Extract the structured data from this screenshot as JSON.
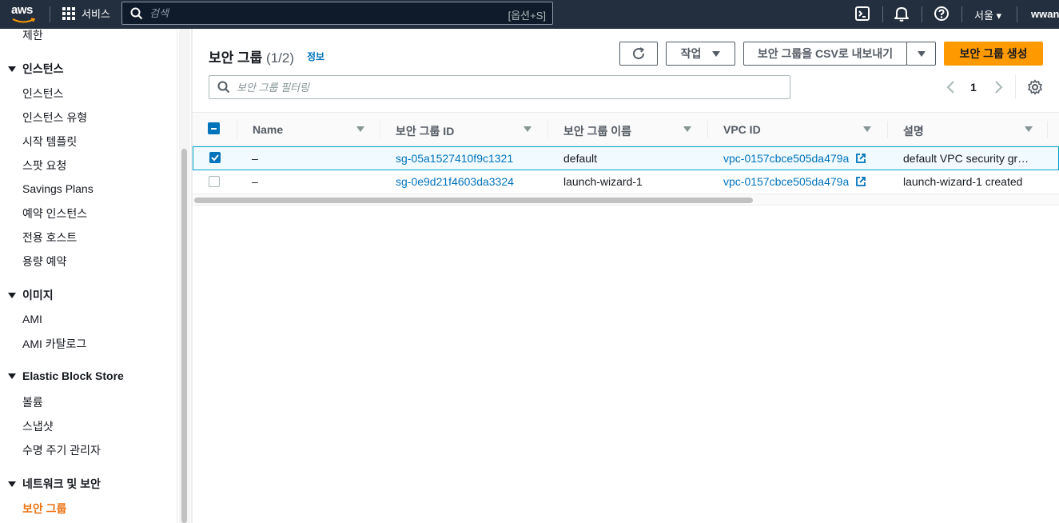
{
  "topnav": {
    "logo_text": "aws",
    "services_label": "서비스",
    "search_placeholder": "검색",
    "search_shortcut": "[옵션+S]",
    "region_label": "서울 ▾",
    "user_label": "wwan"
  },
  "sidebar": {
    "items": [
      {
        "label": "제한",
        "type": "item"
      },
      {
        "label": "인스턴스",
        "type": "section"
      },
      {
        "label": "인스턴스",
        "type": "item"
      },
      {
        "label": "인스턴스 유형",
        "type": "item"
      },
      {
        "label": "시작 템플릿",
        "type": "item"
      },
      {
        "label": "스팟 요청",
        "type": "item"
      },
      {
        "label": "Savings Plans",
        "type": "item"
      },
      {
        "label": "예약 인스턴스",
        "type": "item"
      },
      {
        "label": "전용 호스트",
        "type": "item"
      },
      {
        "label": "용량 예약",
        "type": "item"
      },
      {
        "label": "이미지",
        "type": "section"
      },
      {
        "label": "AMI",
        "type": "item"
      },
      {
        "label": "AMI 카탈로그",
        "type": "item"
      },
      {
        "label": "Elastic Block Store",
        "type": "section"
      },
      {
        "label": "볼륨",
        "type": "item"
      },
      {
        "label": "스냅샷",
        "type": "item"
      },
      {
        "label": "수명 주기 관리자",
        "type": "item"
      },
      {
        "label": "네트워크 및 보안",
        "type": "section"
      },
      {
        "label": "보안 그룹",
        "type": "item",
        "active": true
      }
    ]
  },
  "panel": {
    "title": "보안 그룹",
    "count": "(1/2)",
    "info_link": "정보",
    "actions_label": "작업",
    "export_label": "보안 그룹을 CSV로 내보내기",
    "create_label": "보안 그룹 생성",
    "filter_placeholder": "보안 그룹 필터링",
    "page_number": "1"
  },
  "table": {
    "columns": [
      "Name",
      "보안 그룹 ID",
      "보안 그룹 이름",
      "VPC ID",
      "설명"
    ],
    "rows": [
      {
        "selected": true,
        "name": "–",
        "sg_id": "sg-05a1527410f9c1321",
        "sg_name": "default",
        "vpc_id": "vpc-0157cbce505da479a",
        "description": "default VPC security group"
      },
      {
        "selected": false,
        "name": "–",
        "sg_id": "sg-0e9d21f4603da3324",
        "sg_name": "launch-wizard-1",
        "vpc_id": "vpc-0157cbce505da479a",
        "description": "launch-wizard-1 created"
      }
    ]
  },
  "colors": {
    "nav_bg": "#232f3e",
    "accent_orange": "#ff9900",
    "active_link": "#ec7211",
    "link_blue": "#0073bb"
  }
}
